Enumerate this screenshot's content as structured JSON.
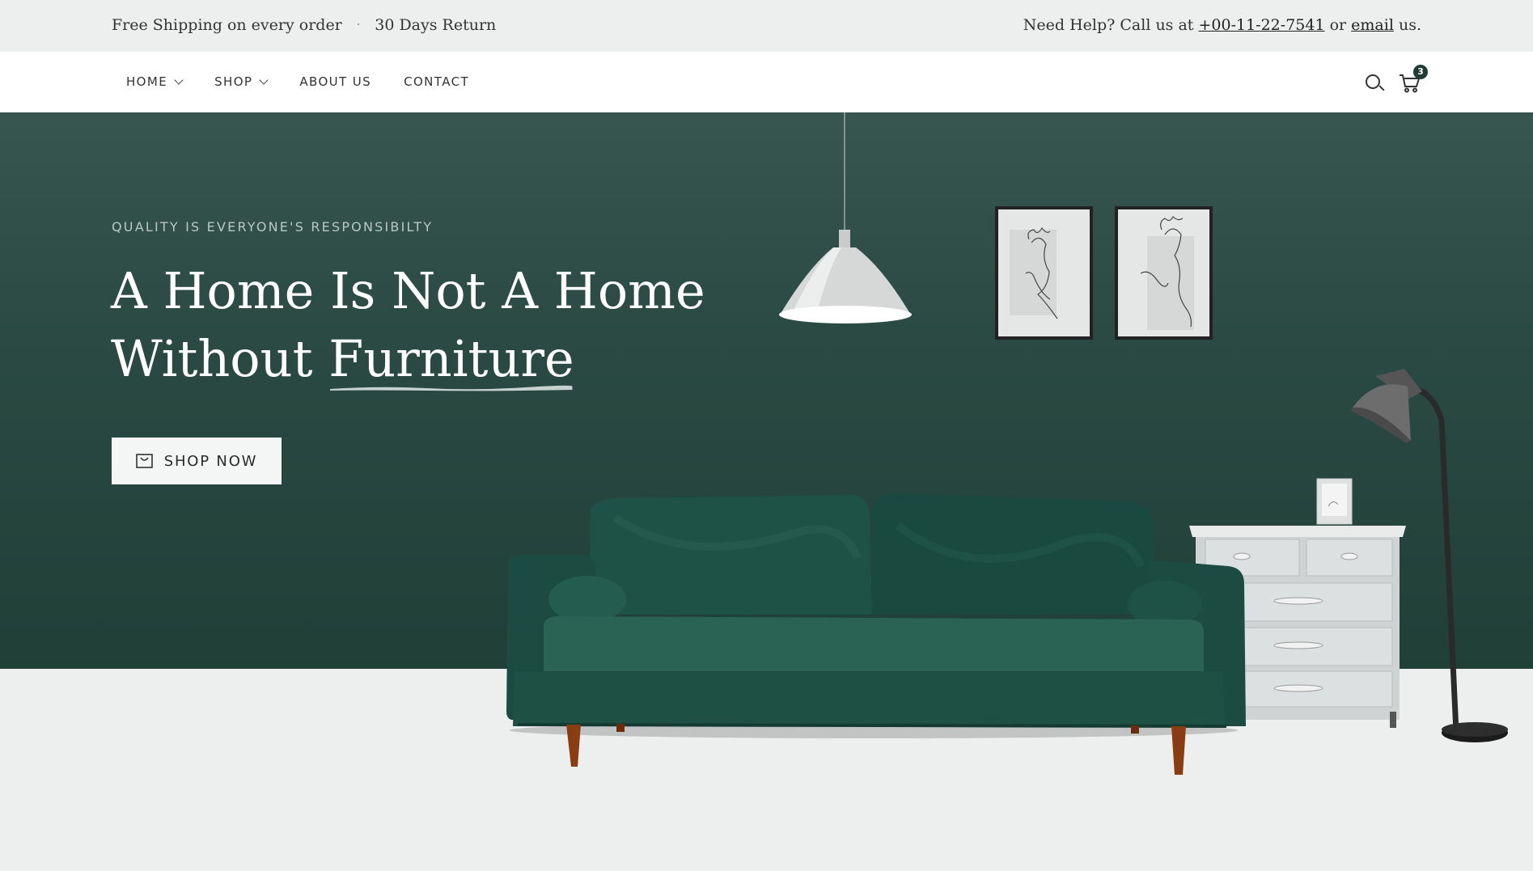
{
  "topbar": {
    "shipping": "Free Shipping on every order",
    "separator": "·",
    "returns": "30 Days Return",
    "help_prefix": "Need Help? Call us at ",
    "phone": "+00-11-22-7541",
    "or_text": " or ",
    "email_label": "email",
    "help_suffix": " us."
  },
  "nav": {
    "items": [
      {
        "label": "HOME",
        "has_dropdown": true
      },
      {
        "label": "SHOP",
        "has_dropdown": true
      },
      {
        "label": "ABOUT US",
        "has_dropdown": false
      },
      {
        "label": "CONTACT",
        "has_dropdown": false
      }
    ],
    "cart_count": "3",
    "icons": [
      "search-icon",
      "cart-icon"
    ]
  },
  "hero": {
    "subtitle": "QUALITY IS EVERYONE'S RESPONSIBILTY",
    "headline_line1": "A Home Is Not A Home",
    "headline_line2_prefix": "Without ",
    "headline_line2_highlight": "Furniture",
    "button_label": "SHOP NOW",
    "button_icon": "shopping-bag-icon"
  },
  "colors": {
    "hero_bg": "#2a4a43",
    "topbar_bg": "#ecefee",
    "sofa": "#1f5246",
    "accent_dark": "#223a35"
  }
}
